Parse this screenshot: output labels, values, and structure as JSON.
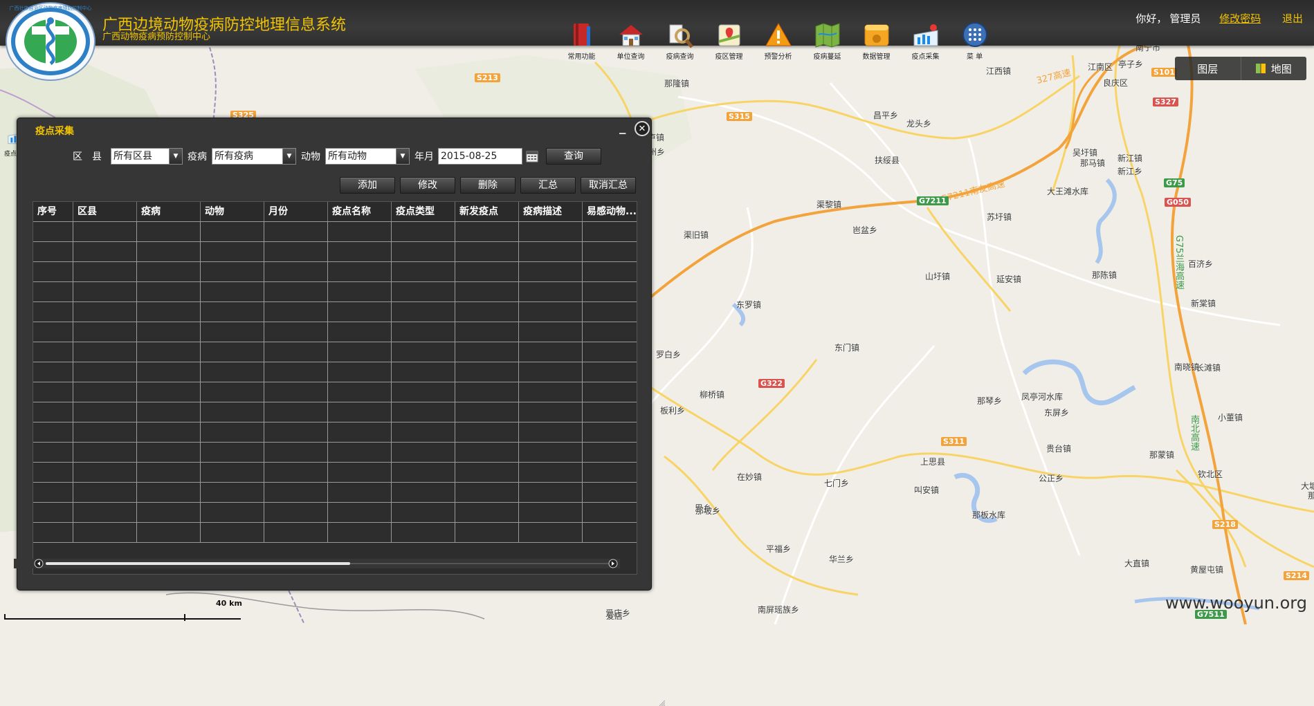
{
  "header": {
    "title": "广西边境动物疫病防控地理信息系统",
    "subtitle": "广西动物疫病预防控制中心",
    "logo_text": "广西壮族自治区动物疫病预防控制中心"
  },
  "toolbar": [
    {
      "label": "常用功能",
      "icon": "book-icon"
    },
    {
      "label": "单位查询",
      "icon": "house-icon"
    },
    {
      "label": "疫病查询",
      "icon": "magnifier-icon"
    },
    {
      "label": "疫区管理",
      "icon": "map-pin-icon"
    },
    {
      "label": "预警分析",
      "icon": "warning-icon"
    },
    {
      "label": "疫病蔓延",
      "icon": "folded-map-icon"
    },
    {
      "label": "数据管理",
      "icon": "database-icon"
    },
    {
      "label": "疫点采集",
      "icon": "chart-pin-icon"
    },
    {
      "label": "菜 单",
      "icon": "grid-menu-icon"
    }
  ],
  "user": {
    "greeting": "你好，",
    "name": "管理员",
    "change_password": "修改密码",
    "logout": "退出"
  },
  "layer_switch": {
    "layers": "图层",
    "map": "地图"
  },
  "mini_icon_label": "疫点采集",
  "dialog": {
    "title": "疫点采集",
    "filters": {
      "district_label": "区　县",
      "district_value": "所有区县",
      "disease_label": "疫病",
      "disease_value": "所有疫病",
      "animal_label": "动物",
      "animal_value": "所有动物",
      "date_label": "年月",
      "date_value": "2015-08-25",
      "query_button": "查询"
    },
    "buttons": {
      "add": "添加",
      "edit": "修改",
      "delete": "删除",
      "summary": "汇总",
      "cancel_summary": "取消汇总"
    },
    "columns": [
      "序号",
      "区县",
      "疫病",
      "动物",
      "月份",
      "疫点名称",
      "疫点类型",
      "新发疫点",
      "疫病描述",
      "易感动物..."
    ],
    "row_count": 16
  },
  "map": {
    "scale_label": "40 km",
    "watermark": "www.wooyun.org",
    "places": [
      {
        "name": "那隆镇"
      },
      {
        "name": "驮卢镇"
      },
      {
        "name": "雷州乡"
      },
      {
        "name": "扶绥县"
      },
      {
        "name": "昌平乡"
      },
      {
        "name": "龙头乡"
      },
      {
        "name": "吴圩镇"
      },
      {
        "name": "那马镇"
      },
      {
        "name": "新江镇"
      },
      {
        "name": "新江乡"
      },
      {
        "name": "江西镇"
      },
      {
        "name": "江南区"
      },
      {
        "name": "良庆区"
      },
      {
        "name": "亭子乡"
      },
      {
        "name": "南宁市"
      },
      {
        "name": "渠黎镇"
      },
      {
        "name": "岜盆乡"
      },
      {
        "name": "苏圩镇"
      },
      {
        "name": "大王滩水库"
      },
      {
        "name": "渠旧镇"
      },
      {
        "name": "山圩镇"
      },
      {
        "name": "延安镇"
      },
      {
        "name": "那陈镇"
      },
      {
        "name": "百济乡"
      },
      {
        "name": "新棠镇"
      },
      {
        "name": "东罗镇"
      },
      {
        "name": "东门镇"
      },
      {
        "name": "罗白乡"
      },
      {
        "name": "南晓镇"
      },
      {
        "name": "长滩镇"
      },
      {
        "name": "柳桥镇"
      },
      {
        "name": "板利乡"
      },
      {
        "name": "那琴乡"
      },
      {
        "name": "凤亭河水库"
      },
      {
        "name": "东屏乡"
      },
      {
        "name": "小董镇"
      },
      {
        "name": "上思县"
      },
      {
        "name": "贵台镇"
      },
      {
        "name": "那蒙镇"
      },
      {
        "name": "钦北区"
      },
      {
        "name": "在妙镇"
      },
      {
        "name": "七门乡"
      },
      {
        "name": "叫安镇"
      },
      {
        "name": "公正乡"
      },
      {
        "name": "那板水库"
      },
      {
        "name": "大直镇"
      },
      {
        "name": "黄屋屯镇"
      },
      {
        "name": "平福乡"
      },
      {
        "name": "华兰乡"
      },
      {
        "name": "南屏瑶族乡"
      },
      {
        "name": "思乡"
      },
      {
        "name": "爱店乡"
      },
      {
        "name": "那坡乡"
      },
      {
        "name": "大塘"
      },
      {
        "name": "那梭乡"
      },
      {
        "name": "爱店"
      }
    ],
    "road_labels": [
      {
        "text": "G7211南友高速"
      },
      {
        "text": "G7211"
      },
      {
        "text": "G322"
      },
      {
        "text": "S315"
      },
      {
        "text": "S213"
      },
      {
        "text": "S311"
      },
      {
        "text": "G75"
      },
      {
        "text": "G050"
      },
      {
        "text": "S325"
      },
      {
        "text": "S327"
      },
      {
        "text": "S101"
      },
      {
        "text": "G75兰海高速"
      },
      {
        "text": "南北高速"
      },
      {
        "text": "S218"
      },
      {
        "text": "S214"
      },
      {
        "text": "G7511"
      },
      {
        "text": "327高速"
      }
    ]
  }
}
